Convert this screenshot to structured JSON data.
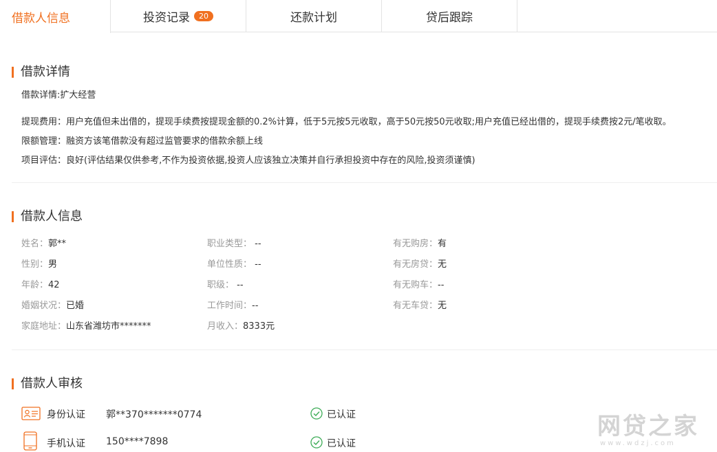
{
  "tabs": [
    {
      "label": "借款人信息",
      "active": true
    },
    {
      "label": "投资记录",
      "badge": "20"
    },
    {
      "label": "还款计划"
    },
    {
      "label": "贷后跟踪"
    }
  ],
  "details": {
    "title": "借款详情",
    "purpose": "借款详情:扩大经营",
    "fee": "提现费用：用户充值但未出借的，提现手续费按提现金额的0.2%计算，低于5元按5元收取，高于50元按50元收取;用户充值已经出借的，提现手续费按2元/笔收取。",
    "limit": "限额管理：融资方该笔借款没有超过监管要求的借款余额上线",
    "evaluation": "项目评估：良好(评估结果仅供参考,不作为投资依据,投资人应该独立决策并自行承担投资中存在的风险,投资须谨慎)"
  },
  "borrower": {
    "title": "借款人信息",
    "col1": [
      {
        "k": "姓名：",
        "v": "郭**"
      },
      {
        "k": "性别：",
        "v": "男"
      },
      {
        "k": "年龄：",
        "v": "42"
      },
      {
        "k": "婚姻状况：",
        "v": "已婚"
      },
      {
        "k": "家庭地址：",
        "v": "山东省潍坊市*******"
      }
    ],
    "col2": [
      {
        "k": "职业类型：",
        "v": " --"
      },
      {
        "k": "单位性质：",
        "v": " --"
      },
      {
        "k": "职级：",
        "v": " --"
      },
      {
        "k": "工作时间：",
        "v": "--"
      },
      {
        "k": "月收入：",
        "v": "8333元"
      }
    ],
    "col3": [
      {
        "k": "有无购房：",
        "v": "有"
      },
      {
        "k": "有无房贷：",
        "v": "无"
      },
      {
        "k": "有无购车：",
        "v": "--"
      },
      {
        "k": "有无车贷：",
        "v": "无"
      }
    ]
  },
  "audit": {
    "title": "借款人审核",
    "rows": [
      {
        "icon": "id-card-icon",
        "label": "身份认证",
        "value": "郭**370*******0774",
        "status": "已认证"
      },
      {
        "icon": "mobile-phone-icon",
        "label": "手机认证",
        "value": "150****7898",
        "status": "已认证"
      }
    ]
  },
  "watermark": {
    "main": "网贷之家",
    "sub": "www.wdzj.com"
  },
  "colors": {
    "accent": "#f07020",
    "check": "#3bab55",
    "muted": "#999999"
  }
}
